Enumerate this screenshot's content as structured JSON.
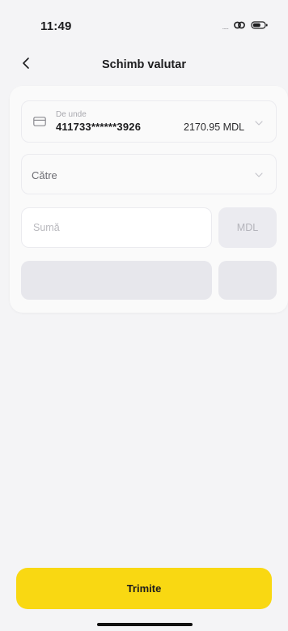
{
  "status_bar": {
    "time": "11:49",
    "signal": ".....",
    "icons": [
      "link-icon",
      "battery-icon"
    ]
  },
  "nav": {
    "back_icon": "chevron-left-icon",
    "title": "Schimb valutar"
  },
  "form": {
    "from": {
      "label": "De unde",
      "card_number": "411733******3926",
      "balance": "2170.95 MDL",
      "icon": "credit-card-icon"
    },
    "to": {
      "label": "Către"
    },
    "amount": {
      "placeholder": "Sumă",
      "value": ""
    },
    "currency": "MDL"
  },
  "submit_label": "Trimite",
  "colors": {
    "accent": "#f9d812",
    "background": "#f4f4f6",
    "card": "#fafafa",
    "placeholder_block": "#e7e7ec"
  }
}
